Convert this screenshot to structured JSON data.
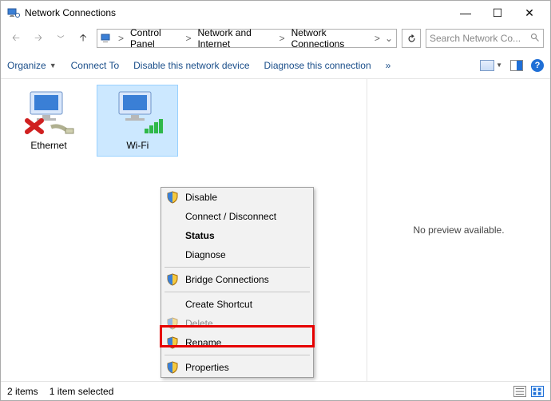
{
  "window": {
    "title": "Network Connections"
  },
  "breadcrumb": {
    "root_sep": ">",
    "items": [
      "Control Panel",
      "Network and Internet",
      "Network Connections"
    ]
  },
  "search": {
    "placeholder": "Search Network Co..."
  },
  "toolbar": {
    "organize": "Organize",
    "connect": "Connect To",
    "disable": "Disable this network device",
    "diagnose": "Diagnose this connection",
    "more": "»"
  },
  "adapters": {
    "ethernet": "Ethernet",
    "wifi": "Wi-Fi"
  },
  "context_menu": {
    "disable": "Disable",
    "connect": "Connect / Disconnect",
    "status": "Status",
    "diagnose": "Diagnose",
    "bridge": "Bridge Connections",
    "shortcut": "Create Shortcut",
    "delete": "Delete",
    "rename": "Rename",
    "properties": "Properties"
  },
  "preview": {
    "empty": "No preview available."
  },
  "status": {
    "count": "2 items",
    "selected": "1 item selected"
  }
}
